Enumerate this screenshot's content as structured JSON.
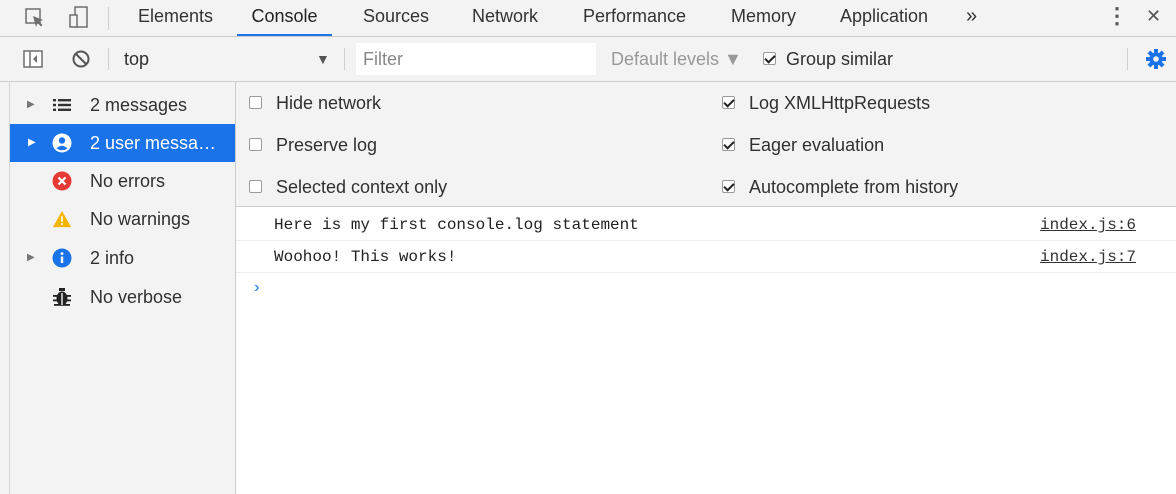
{
  "tabbar": {
    "tabs": [
      {
        "label": "Elements"
      },
      {
        "label": "Console"
      },
      {
        "label": "Sources"
      },
      {
        "label": "Network"
      },
      {
        "label": "Performance"
      },
      {
        "label": "Memory"
      },
      {
        "label": "Application"
      }
    ],
    "active_tab": "Console",
    "more_label": "»",
    "kebab_label": "⋮",
    "close_label": "✕"
  },
  "toolbar": {
    "context": "top",
    "context_arrow": "▼",
    "filter_placeholder": "Filter",
    "levels_label": "Default levels ▼",
    "group_similar_label": "Group similar",
    "group_similar_checked": true
  },
  "sidebar": {
    "items": [
      {
        "label": "2 messages",
        "icon": "list-icon",
        "expandable": true
      },
      {
        "label": "2 user messa…",
        "icon": "user-icon",
        "expandable": true,
        "selected": true
      },
      {
        "label": "No errors",
        "icon": "error-icon"
      },
      {
        "label": "No warnings",
        "icon": "warning-icon"
      },
      {
        "label": "2 info",
        "icon": "info-icon",
        "expandable": true
      },
      {
        "label": "No verbose",
        "icon": "bug-icon"
      }
    ]
  },
  "settings": {
    "left": [
      {
        "label": "Hide network",
        "checked": false
      },
      {
        "label": "Preserve log",
        "checked": false
      },
      {
        "label": "Selected context only",
        "checked": false
      }
    ],
    "right": [
      {
        "label": "Log XMLHttpRequests",
        "checked": true
      },
      {
        "label": "Eager evaluation",
        "checked": true
      },
      {
        "label": "Autocomplete from history",
        "checked": true
      }
    ]
  },
  "messages": [
    {
      "text": "Here is my first console.log statement",
      "source": "index.js:6"
    },
    {
      "text": "Woohoo! This works!",
      "source": "index.js:7"
    }
  ],
  "prompt": "›",
  "colors": {
    "accent": "#1a73e8",
    "error": "#e53935",
    "warning": "#f4b400",
    "info": "#1a73e8",
    "toolbar_bg": "#f3f3f3"
  }
}
